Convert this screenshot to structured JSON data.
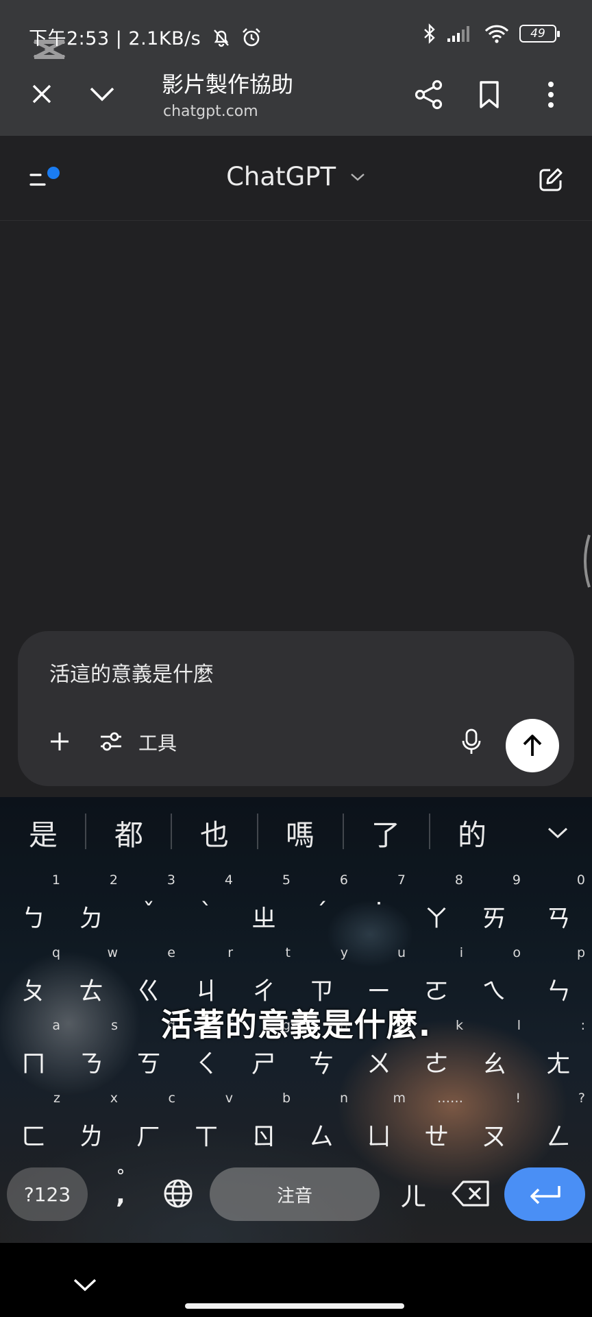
{
  "status_bar": {
    "time": "下午2:53",
    "network_speed": "2.1KB/s",
    "battery": "49"
  },
  "browser": {
    "page_title": "影片製作協助",
    "url": "chatgpt.com"
  },
  "chat": {
    "model_name": "ChatGPT",
    "input_text": "活這的意義是什麼",
    "tools_label": "工具"
  },
  "keyboard": {
    "suggestions": [
      "是",
      "都",
      "也",
      "嗎",
      "了",
      "的"
    ],
    "rows": [
      [
        [
          "1",
          "ㄅ"
        ],
        [
          "2",
          "ㄉ"
        ],
        [
          "3",
          "ˇ"
        ],
        [
          "4",
          "ˋ"
        ],
        [
          "5",
          "ㄓ"
        ],
        [
          "6",
          "ˊ"
        ],
        [
          "7",
          "˙"
        ],
        [
          "8",
          "ㄚ"
        ],
        [
          "9",
          "ㄞ"
        ],
        [
          "0",
          "ㄢ"
        ]
      ],
      [
        [
          "q",
          "ㄆ"
        ],
        [
          "w",
          "ㄊ"
        ],
        [
          "e",
          "ㄍ"
        ],
        [
          "r",
          "ㄐ"
        ],
        [
          "t",
          "ㄔ"
        ],
        [
          "y",
          "ㄗ"
        ],
        [
          "u",
          "ㄧ"
        ],
        [
          "i",
          "ㄛ"
        ],
        [
          "o",
          "ㄟ"
        ],
        [
          "p",
          "ㄣ"
        ]
      ],
      [
        [
          "a",
          "ㄇ"
        ],
        [
          "s",
          "ㄋ"
        ],
        [
          "d",
          "ㄎ"
        ],
        [
          "f",
          "ㄑ"
        ],
        [
          "g",
          "ㄕ"
        ],
        [
          "h",
          "ㄘ"
        ],
        [
          "j",
          "ㄨ"
        ],
        [
          "k",
          "ㄜ"
        ],
        [
          "l",
          "ㄠ"
        ],
        [
          ":",
          "ㄤ"
        ]
      ],
      [
        [
          "z",
          "ㄈ"
        ],
        [
          "x",
          "ㄌ"
        ],
        [
          "c",
          "ㄏ"
        ],
        [
          "v",
          "ㄒ"
        ],
        [
          "b",
          "ㄖ"
        ],
        [
          "n",
          "ㄙ"
        ],
        [
          "m",
          "ㄩ"
        ],
        [
          "……",
          "ㄝ"
        ],
        [
          "!",
          "ㄡ"
        ],
        [
          "?",
          "ㄥ"
        ]
      ]
    ],
    "symbols_label": "?123",
    "punct_top": "°",
    "punct_bottom": ",",
    "space_label": "注音",
    "er_key": "ㄦ",
    "video_caption": "活著的意義是什麼."
  },
  "colors": {
    "topbar": "#38393b",
    "chat_bg": "#212123",
    "composer_bg": "#303033",
    "accent_blue": "#1a7cf2",
    "enter_key": "#4a8ff5"
  }
}
